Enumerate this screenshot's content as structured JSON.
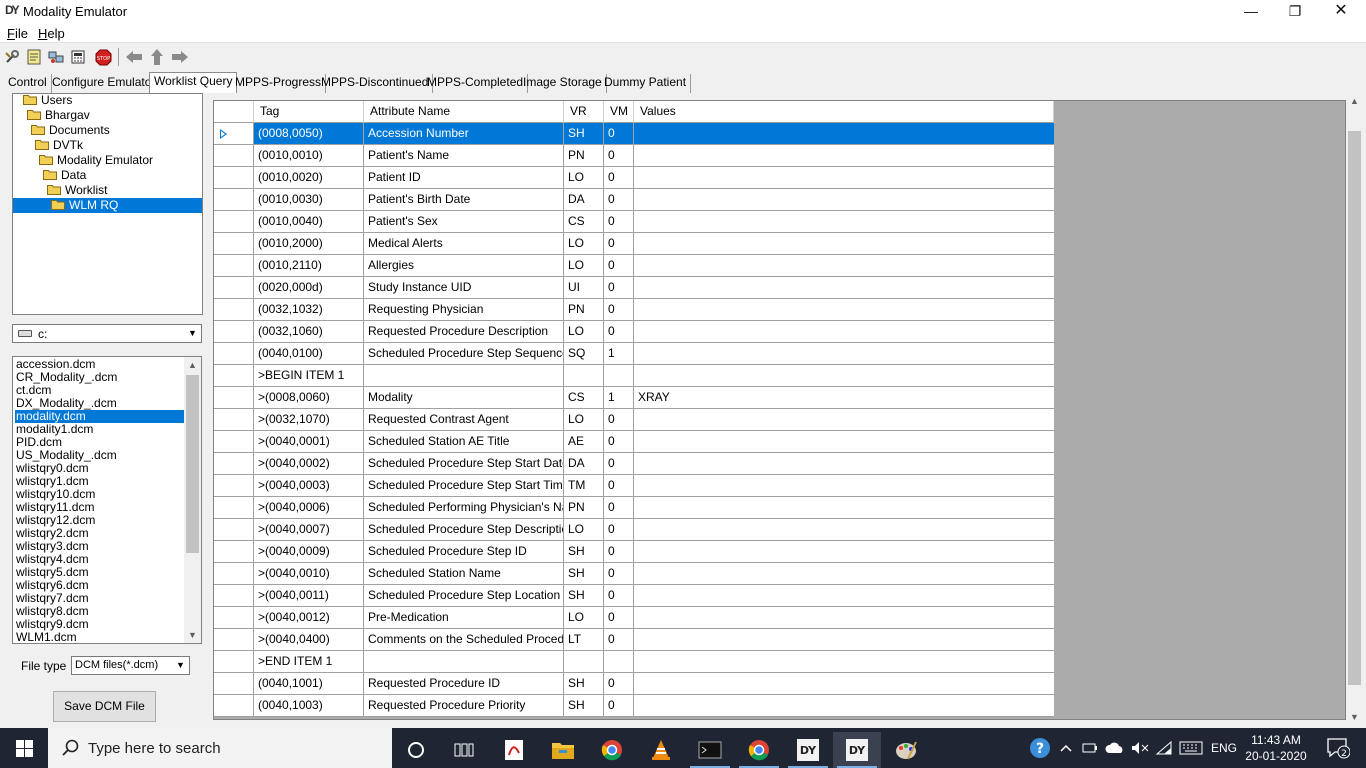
{
  "window": {
    "title": "Modality Emulator",
    "icon_glyph": "DY",
    "minimize": "—",
    "maximize": "❐",
    "close": "✕"
  },
  "menu": {
    "file": "File",
    "help": "Help"
  },
  "toolbar": {
    "buttons": [
      "settings-icon",
      "notes-icon",
      "network-icon",
      "calculator-icon",
      "stop-icon",
      "arrow-left-icon",
      "arrow-up-icon",
      "arrow-right-icon"
    ],
    "stop_text": "STOP"
  },
  "tabs": [
    "Control",
    "Configure Emulator",
    "Worklist Query",
    "MPPS-Progress",
    "MPPS-Discontinued",
    "MPPS-Completed",
    "Image Storage",
    "Dummy Patient"
  ],
  "active_tab": "Worklist Query",
  "tree": {
    "items": [
      {
        "label": "Users"
      },
      {
        "label": "Bhargav"
      },
      {
        "label": "Documents"
      },
      {
        "label": "DVTk"
      },
      {
        "label": "Modality Emulator"
      },
      {
        "label": "Data"
      },
      {
        "label": "Worklist"
      },
      {
        "label": "WLM RQ"
      }
    ],
    "selected": "WLM RQ"
  },
  "drive": {
    "value": "c:"
  },
  "files": {
    "items": [
      "accession.dcm",
      "CR_Modality_.dcm",
      "ct.dcm",
      "DX_Modality_.dcm",
      "modality.dcm",
      "modality1.dcm",
      "PID.dcm",
      "US_Modality_.dcm",
      "wlistqry0.dcm",
      "wlistqry1.dcm",
      "wlistqry10.dcm",
      "wlistqry11.dcm",
      "wlistqry12.dcm",
      "wlistqry2.dcm",
      "wlistqry3.dcm",
      "wlistqry4.dcm",
      "wlistqry5.dcm",
      "wlistqry6.dcm",
      "wlistqry7.dcm",
      "wlistqry8.dcm",
      "wlistqry9.dcm",
      "WLM1.dcm"
    ],
    "selected": "modality.dcm"
  },
  "filetype": {
    "label": "File type",
    "value": "DCM files(*.dcm)"
  },
  "save_button": "Save DCM File",
  "grid": {
    "columns": [
      "Tag",
      "Attribute Name",
      "VR",
      "VM",
      "Values"
    ],
    "rows": [
      {
        "tag": "(0008,0050)",
        "name": "Accession Number",
        "vr": "SH",
        "vm": "0",
        "value": ""
      },
      {
        "tag": "(0010,0010)",
        "name": "Patient's Name",
        "vr": "PN",
        "vm": "0",
        "value": ""
      },
      {
        "tag": "(0010,0020)",
        "name": "Patient ID",
        "vr": "LO",
        "vm": "0",
        "value": ""
      },
      {
        "tag": "(0010,0030)",
        "name": "Patient's Birth Date",
        "vr": "DA",
        "vm": "0",
        "value": ""
      },
      {
        "tag": "(0010,0040)",
        "name": "Patient's Sex",
        "vr": "CS",
        "vm": "0",
        "value": ""
      },
      {
        "tag": "(0010,2000)",
        "name": "Medical Alerts",
        "vr": "LO",
        "vm": "0",
        "value": ""
      },
      {
        "tag": "(0010,2110)",
        "name": "Allergies",
        "vr": "LO",
        "vm": "0",
        "value": ""
      },
      {
        "tag": "(0020,000d)",
        "name": "Study Instance UID",
        "vr": "UI",
        "vm": "0",
        "value": ""
      },
      {
        "tag": "(0032,1032)",
        "name": "Requesting Physician",
        "vr": "PN",
        "vm": "0",
        "value": ""
      },
      {
        "tag": "(0032,1060)",
        "name": "Requested Procedure Description",
        "vr": "LO",
        "vm": "0",
        "value": ""
      },
      {
        "tag": "(0040,0100)",
        "name": "Scheduled Procedure Step Sequence",
        "vr": "SQ",
        "vm": "1",
        "value": ""
      },
      {
        "tag": ">BEGIN ITEM 1",
        "name": "",
        "vr": "",
        "vm": "",
        "value": ""
      },
      {
        "tag": ">(0008,0060)",
        "name": "Modality",
        "vr": "CS",
        "vm": "1",
        "value": "XRAY"
      },
      {
        "tag": ">(0032,1070)",
        "name": "Requested Contrast Agent",
        "vr": "LO",
        "vm": "0",
        "value": ""
      },
      {
        "tag": ">(0040,0001)",
        "name": "Scheduled Station AE Title",
        "vr": "AE",
        "vm": "0",
        "value": ""
      },
      {
        "tag": ">(0040,0002)",
        "name": "Scheduled Procedure Step Start Date",
        "vr": "DA",
        "vm": "0",
        "value": ""
      },
      {
        "tag": ">(0040,0003)",
        "name": "Scheduled Procedure Step Start Time",
        "vr": "TM",
        "vm": "0",
        "value": ""
      },
      {
        "tag": ">(0040,0006)",
        "name": "Scheduled Performing Physician's Name",
        "vr": "PN",
        "vm": "0",
        "value": ""
      },
      {
        "tag": ">(0040,0007)",
        "name": "Scheduled Procedure Step Description",
        "vr": "LO",
        "vm": "0",
        "value": ""
      },
      {
        "tag": ">(0040,0009)",
        "name": "Scheduled Procedure Step ID",
        "vr": "SH",
        "vm": "0",
        "value": ""
      },
      {
        "tag": ">(0040,0010)",
        "name": "Scheduled Station Name",
        "vr": "SH",
        "vm": "0",
        "value": ""
      },
      {
        "tag": ">(0040,0011)",
        "name": "Scheduled Procedure Step Location",
        "vr": "SH",
        "vm": "0",
        "value": ""
      },
      {
        "tag": ">(0040,0012)",
        "name": "Pre-Medication",
        "vr": "LO",
        "vm": "0",
        "value": ""
      },
      {
        "tag": ">(0040,0400)",
        "name": "Comments on the Scheduled Procedur...",
        "vr": "LT",
        "vm": "0",
        "value": ""
      },
      {
        "tag": ">END ITEM 1",
        "name": "",
        "vr": "",
        "vm": "",
        "value": ""
      },
      {
        "tag": "(0040,1001)",
        "name": "Requested Procedure ID",
        "vr": "SH",
        "vm": "0",
        "value": ""
      },
      {
        "tag": "(0040,1003)",
        "name": "Requested Procedure Priority",
        "vr": "SH",
        "vm": "0",
        "value": ""
      }
    ],
    "selected_row": 0
  },
  "taskbar": {
    "search_placeholder": "Type here to search",
    "apps": [
      "cortana-icon",
      "task-view-icon",
      "pdf-app-icon",
      "file-explorer-icon",
      "chrome-icon",
      "vlc-icon",
      "terminal-icon",
      "chrome-icon",
      "dvtk-icon",
      "dvtk-icon",
      "paint-icon"
    ],
    "app_glyphs": {
      "dvtk": "DY"
    },
    "language": "ENG",
    "time": "11:43 AM",
    "date": "20-01-2020",
    "notification_count": "2"
  },
  "colors": {
    "selection": "#0078d7",
    "taskbar": "#1f2533",
    "grid_background": "#ababab"
  }
}
